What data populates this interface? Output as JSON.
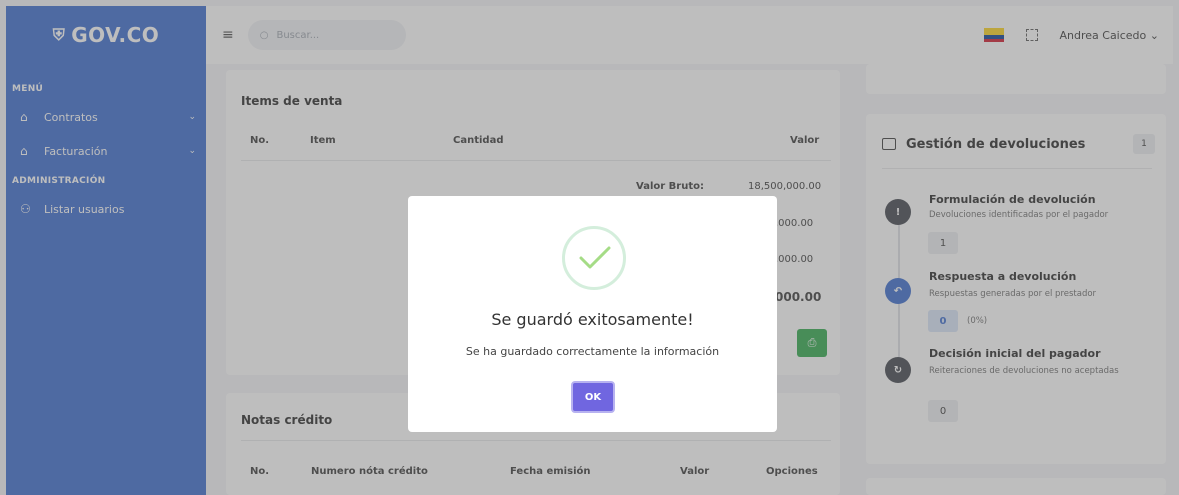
{
  "brand": {
    "logo_text": "GOV.CO",
    "logo_icon": "shield-icon"
  },
  "sidebar": {
    "section_menu": "MENÚ",
    "items": [
      {
        "label": "Contratos",
        "icon": "home-icon"
      },
      {
        "label": "Facturación",
        "icon": "home-icon"
      }
    ],
    "section_admin": "ADMINISTRACIÓN",
    "admin_items": [
      {
        "label": "Listar usuarios",
        "icon": "user-icon"
      }
    ]
  },
  "topbar": {
    "search_placeholder": "Buscar...",
    "user_name": "Andrea Caicedo"
  },
  "items_card": {
    "title": "Items de venta",
    "headers": [
      "No.",
      "Item",
      "Cantidad",
      "Valor"
    ],
    "totals": [
      {
        "label": "Valor Bruto:",
        "value": "18,500,000.00"
      },
      {
        "label": "",
        "value": ",000.00"
      },
      {
        "label": "",
        "value": ",000.00"
      },
      {
        "label": "",
        "value": "000.00"
      }
    ]
  },
  "notes_card": {
    "title": "Notas crédito",
    "headers": [
      "No.",
      "Numero nóta crédito",
      "Fecha emisión",
      "Valor",
      "Opciones"
    ]
  },
  "gestion": {
    "title": "Gestión de devoluciones",
    "badge": "1",
    "steps": [
      {
        "title": "Formulación de devolución",
        "subtitle": "Devoluciones identificadas por el pagador",
        "count": "1",
        "pct": ""
      },
      {
        "title": "Respuesta a devolución",
        "subtitle": "Respuestas generadas por el prestador",
        "count": "0",
        "pct": "(0%)"
      },
      {
        "title": "Decisión inicial del pagador",
        "subtitle": "Reiteraciones de devoluciones no aceptadas",
        "count": "0",
        "pct": ""
      }
    ]
  },
  "modal": {
    "title": "Se guardó exitosamente!",
    "message": "Se ha guardado correctamente la información",
    "ok_label": "OK"
  },
  "colors": {
    "sidebar": "#3366cc",
    "success": "#28a745",
    "ok_button": "#7066e0",
    "check": "#a5dc86"
  }
}
